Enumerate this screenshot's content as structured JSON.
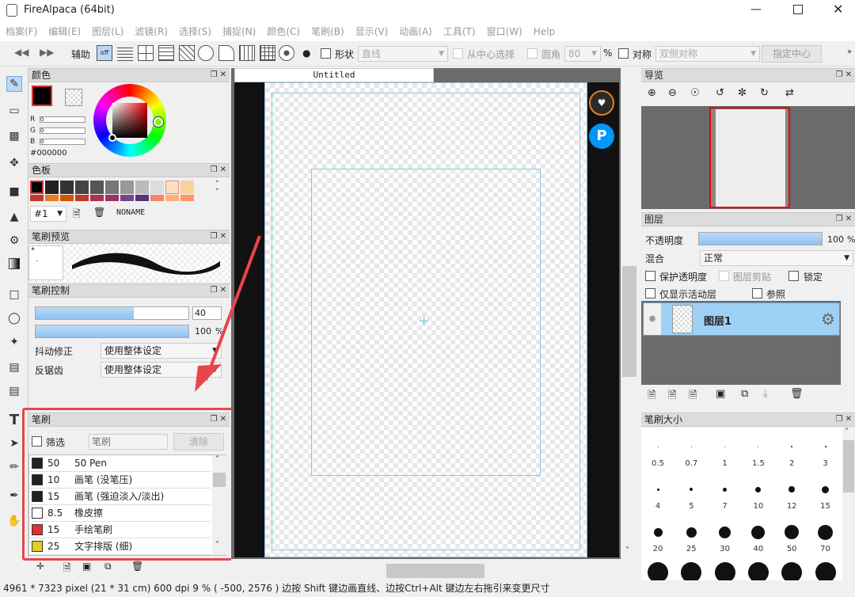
{
  "window": {
    "title": "FireAlpaca (64bit)"
  },
  "menu": [
    "档案(F)",
    "编辑(E)",
    "图层(L)",
    "滤镜(R)",
    "选择(S)",
    "捕捉(N)",
    "颜色(C)",
    "笔刷(B)",
    "显示(V)",
    "动画(A)",
    "工具(T)",
    "窗口(W)",
    "Help"
  ],
  "toolbar": {
    "assist_label": "辅助",
    "shape_label": "形状",
    "shape_value": "直线",
    "from_center_label": "从中心选择",
    "round_label": "圆角",
    "round_value": "80",
    "round_unit": "%",
    "symmetry_label": "对称",
    "symmetry_value": "双侧对称",
    "center_button": "指定中心"
  },
  "color_panel": {
    "title": "颜色",
    "r": "0",
    "g": "0",
    "b": "0",
    "r_label": "R",
    "g_label": "G",
    "b_label": "B",
    "hex": "#000000"
  },
  "palette_panel": {
    "title": "色板",
    "select_value": "#1",
    "name": "NONAME",
    "row1": [
      "#000000",
      "#222222",
      "#333333",
      "#444444",
      "#555555",
      "#777777",
      "#999999",
      "#bbbbbb",
      "#dddddd",
      "#fbe0c0",
      "#f8d29a"
    ],
    "row2": [
      "#c0392b",
      "#e67e22",
      "#d35400",
      "#c0392b",
      "#aa3355",
      "#993366",
      "#774488",
      "#553377",
      "#ee8866",
      "#ffb077",
      "#ff9966"
    ]
  },
  "brush_preview": {
    "title": "笔刷预览"
  },
  "brush_control": {
    "title": "笔刷控制",
    "size_value": "40",
    "opacity_value": "100",
    "opacity_unit": "%",
    "stabilizer_label": "抖动修正",
    "stabilizer_value": "使用整体设定",
    "antialias_label": "反锯齿",
    "antialias_value": "使用整体设定"
  },
  "brush_panel": {
    "title": "笔刷",
    "filter_label": "筛选",
    "filter_placeholder": "笔刷",
    "clear_button": "清除",
    "items": [
      {
        "size": "50",
        "name": "50 Pen",
        "color": "#222222"
      },
      {
        "size": "10",
        "name": "画笔 (没笔压)",
        "color": "#222222"
      },
      {
        "size": "15",
        "name": "画笔 (强迫淡入/淡出)",
        "color": "#222222"
      },
      {
        "size": "8.5",
        "name": "橡皮擦",
        "color": "#ffffff"
      },
      {
        "size": "15",
        "name": "手绘笔刷",
        "color": "#e03030"
      },
      {
        "size": "25",
        "name": "文字排版 (细)",
        "color": "#e0d020"
      }
    ]
  },
  "canvas": {
    "tab": "Untitled"
  },
  "navigator": {
    "title": "导览"
  },
  "layer_panel": {
    "title": "图层",
    "opacity_label": "不透明度",
    "opacity_value": "100",
    "opacity_unit": "%",
    "blend_label": "混合",
    "blend_value": "正常",
    "protect_alpha": "保护透明度",
    "clipping": "图层剪贴",
    "lock": "锁定",
    "show_active": "仅显示活动层",
    "reference": "参照",
    "layer_name": "图层1"
  },
  "brush_size_panel": {
    "title": "笔刷大小",
    "sizes": [
      "0.5",
      "0.7",
      "1",
      "1.5",
      "2",
      "3",
      "4",
      "5",
      "7",
      "10",
      "12",
      "15",
      "20",
      "25",
      "30",
      "40",
      "50",
      "70"
    ]
  },
  "status": "4961 * 7323 pixel   (21 * 31 cm)   600 dpi   9 %   ( -500, 2576 )   边按 Shift 键边画直线、边按Ctrl+Alt 键边左右拖引来变更尺寸",
  "highlight_color": "#e8454b"
}
